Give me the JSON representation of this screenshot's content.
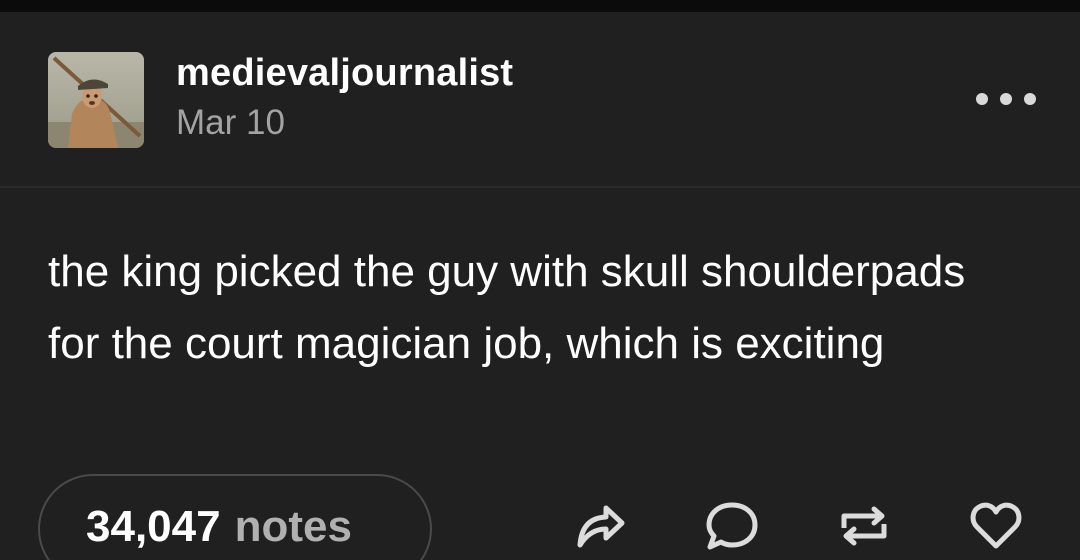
{
  "post": {
    "username": "medievaljournalist",
    "date": "Mar 10",
    "body": "the king picked the guy with skull shoulderpads for the court magician job, which is exciting",
    "notes_count": "34,047",
    "notes_label": "notes"
  },
  "icons": {
    "avatar": "avatar-painting",
    "more": "more-options-icon",
    "share": "share-icon",
    "reply": "reply-icon",
    "reblog": "reblog-icon",
    "like": "heart-icon"
  },
  "colors": {
    "background": "#202020",
    "text": "#ffffff",
    "muted": "#a3a3a3",
    "icon": "#dcdcdc"
  }
}
